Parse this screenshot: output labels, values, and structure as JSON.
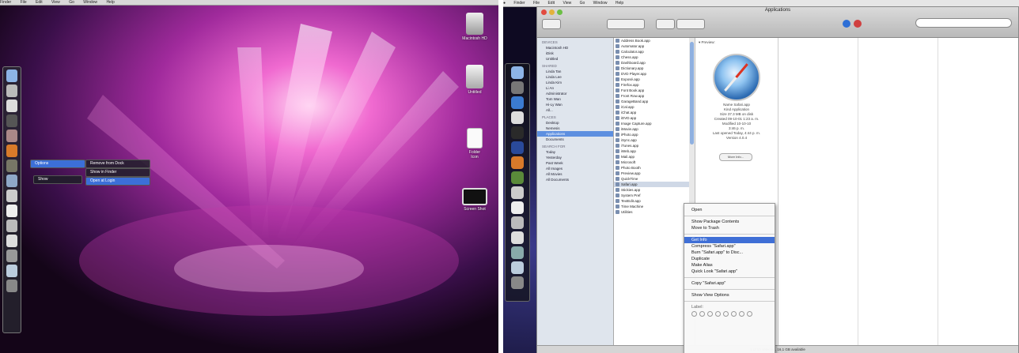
{
  "left_screen": {
    "menubar": [
      "Finder",
      "File",
      "Edit",
      "View",
      "Go",
      "Window",
      "Help"
    ],
    "desktop_icons": [
      {
        "label": "Macintosh HD"
      },
      {
        "label": "Untitled"
      },
      {
        "label": "Folder\nIcon"
      },
      {
        "label": "Screen Shot"
      }
    ],
    "stack_menu": {
      "items_col1": [
        "Options",
        "Show"
      ],
      "items_col2": [
        "Remove from Dock",
        "Show in Finder",
        "Open at Login"
      ],
      "selected": "Open at Login"
    }
  },
  "right_screen": {
    "menubar": [
      "Finder",
      "File",
      "Edit",
      "View",
      "Go",
      "Window",
      "Help"
    ],
    "window_title": "Applications",
    "sidebar": {
      "devices_header": "DEVICES",
      "devices": [
        "Macintosh HD",
        "iDisk",
        "Untitled"
      ],
      "shared_header": "SHARED",
      "shared": [
        "Linda Tan",
        "Linda Lee",
        "Linda Kim",
        "Li An",
        "Administrator",
        "Tom Wan",
        "Hi-Ly Wan",
        "All..."
      ],
      "places_header": "PLACES",
      "places": [
        "Desktop",
        "Nemesis",
        "Applications",
        "Documents"
      ],
      "search_header": "SEARCH FOR",
      "search_for": [
        "Today",
        "Yesterday",
        "Past Week",
        "All Images",
        "All Movies",
        "All Documents"
      ],
      "selected": "Applications"
    },
    "app_list": [
      "Address Book.app",
      "Automator.app",
      "Calculator.app",
      "Chess.app",
      "Dashboard.app",
      "Dictionary.app",
      "DVD Player.app",
      "Exposé.app",
      "Firefox.app",
      "Font Book.app",
      "Front Row.app",
      "GarageBand.app",
      "iCal.app",
      "iChat.app",
      "iDVD.app",
      "Image Capture.app",
      "iMovie.app",
      "iPhoto.app",
      "iSync.app",
      "iTunes.app",
      "iWeb.app",
      "Mail.app",
      "Microsoft",
      "Photo Booth",
      "Preview.app",
      "QuickTime",
      "Safari.app",
      "Stickies.app",
      "System Pref",
      "TextEdit.app",
      "Time Machine",
      "Utilities"
    ],
    "selected_app": "Safari.app",
    "preview": {
      "section": "▾ Preview:",
      "info_lines": [
        "Name  Safari.app",
        "Kind  Application",
        "Size  37.3 MB on disk",
        "Created  09-10-01  1:23 a. m.",
        "Modified  10-10-10",
        "3:46 p. m.",
        "Last opened  Today, 4:44 p. m.",
        "Version  4.0.4"
      ],
      "button": "More Info..."
    },
    "context_menu": {
      "group1": [
        "Open"
      ],
      "group2": [
        "Show Package Contents",
        "Move to Trash"
      ],
      "group3": [
        "Get Info",
        "Compress \"Safari.app\"",
        "Burn \"Safari.app\" to Disc...",
        "Duplicate",
        "Make Alias",
        "Quick Look \"Safari.app\""
      ],
      "group4": [
        "Copy \"Safari.app\""
      ],
      "group5": [
        "Show View Options"
      ],
      "label_header": "Label:",
      "selected": "Get Info"
    },
    "status_bar": "1 of 56 selected, 16,1 GB available"
  },
  "colors": {
    "selection_blue": "#3f6fd6",
    "wallpaper_pink": "#e04fb8",
    "wallpaper_deep": "#3a0f4a"
  }
}
